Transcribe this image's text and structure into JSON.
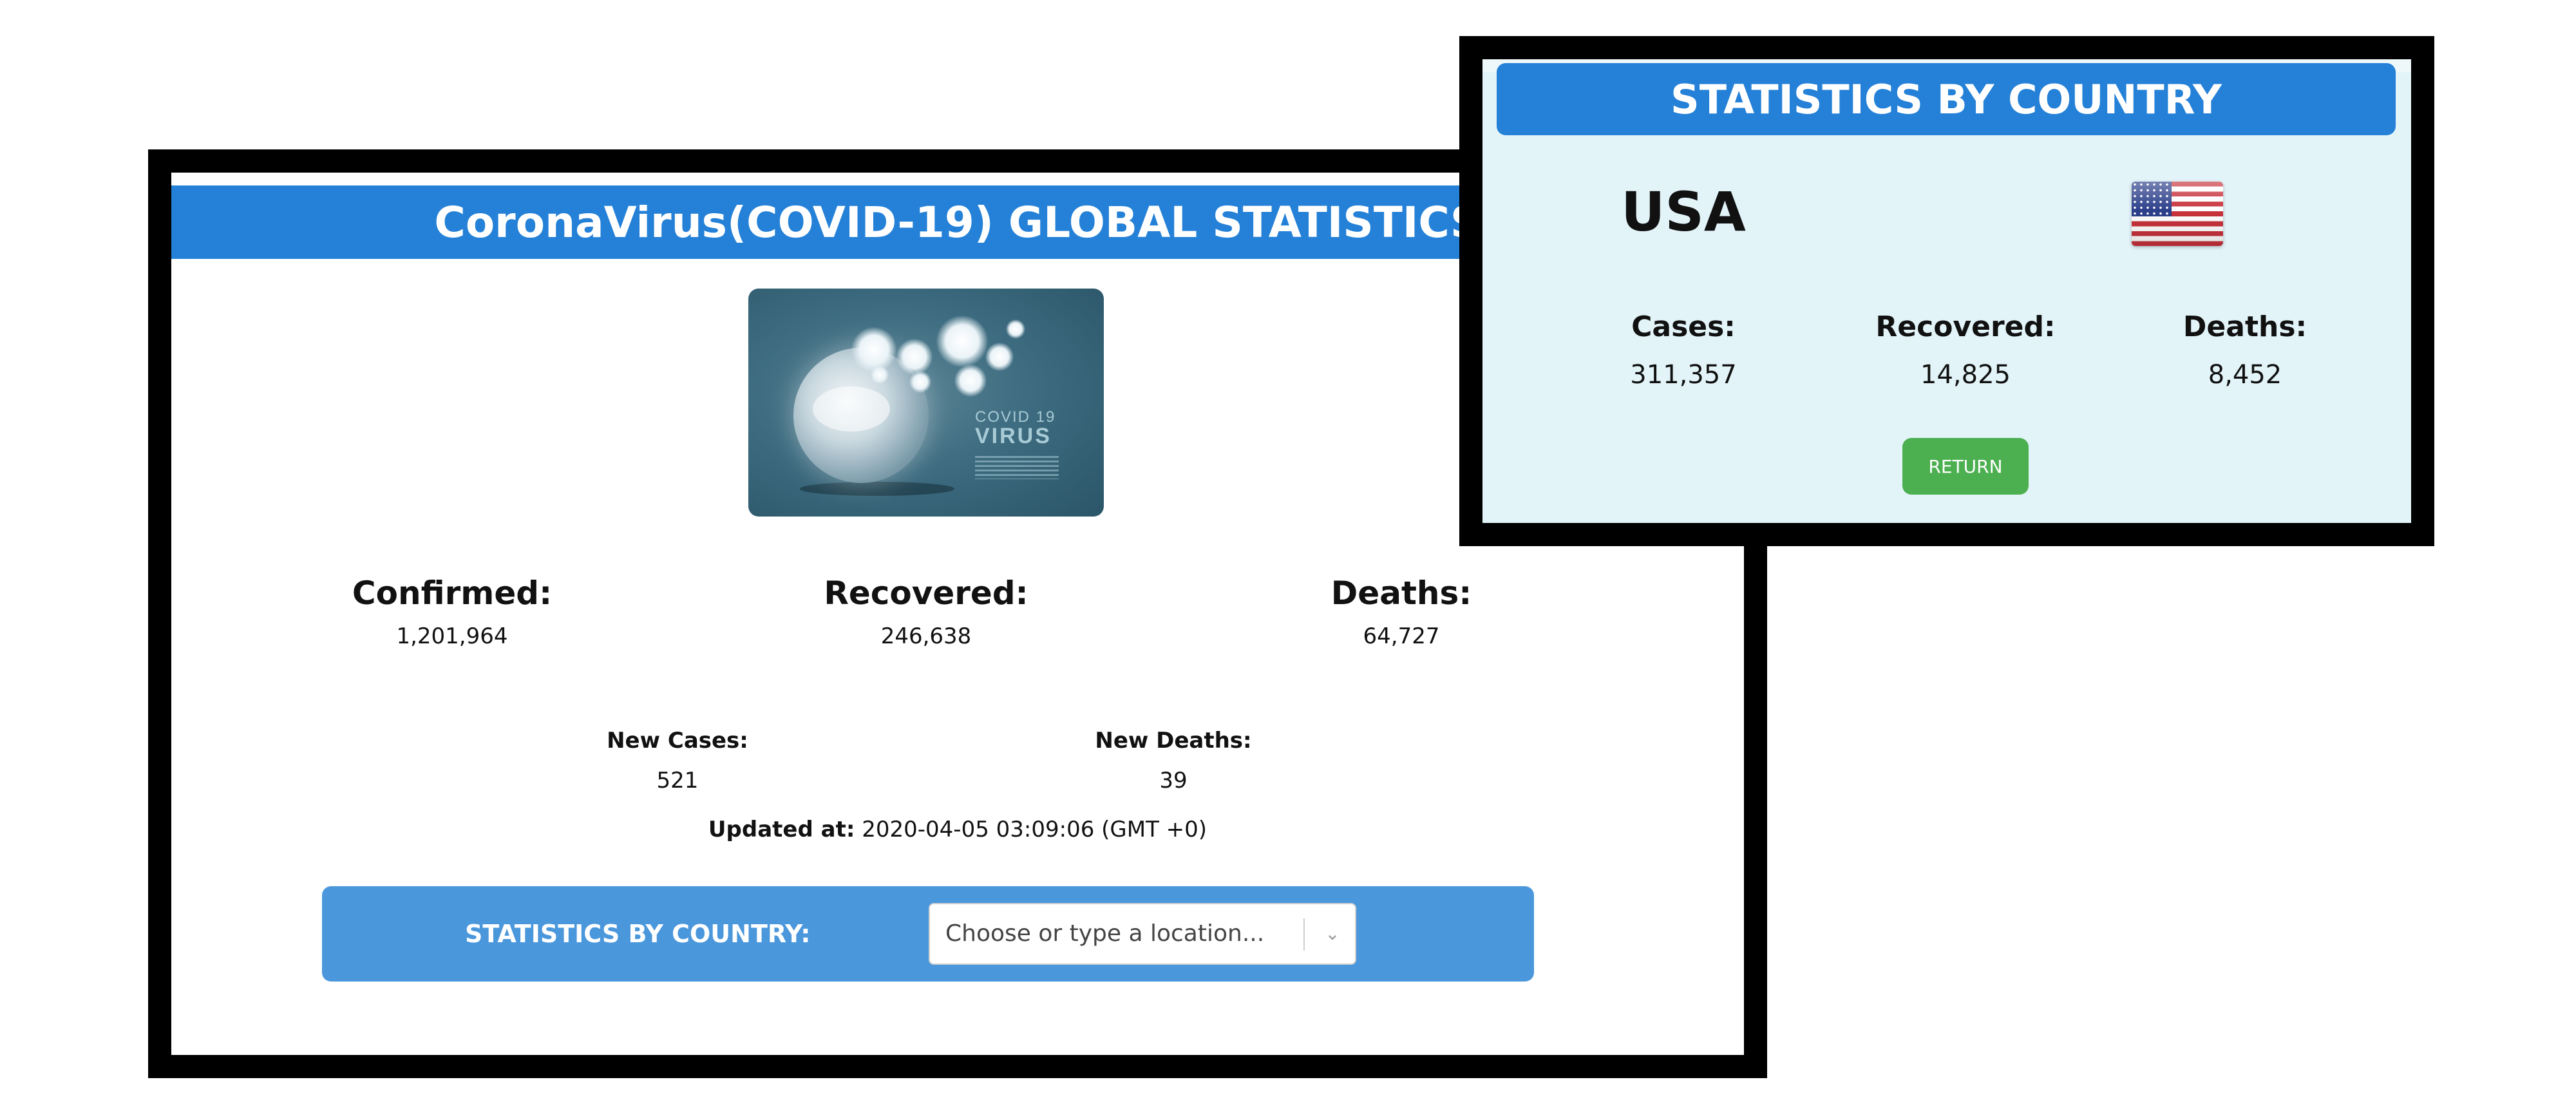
{
  "global": {
    "title": "CoronaVirus(COVID-19) GLOBAL STATISTICS",
    "image": {
      "line1": "COVID 19",
      "line2": "VIRUS"
    },
    "stats": {
      "confirmed_label": "Confirmed:",
      "confirmed_value": "1,201,964",
      "recovered_label": "Recovered:",
      "recovered_value": "246,638",
      "deaths_label": "Deaths:",
      "deaths_value": "64,727",
      "new_cases_label": "New Cases:",
      "new_cases_value": "521",
      "new_deaths_label": "New Deaths:",
      "new_deaths_value": "39"
    },
    "updated_label": "Updated at:",
    "updated_value": "2020-04-05 03:09:06 (GMT +0)",
    "country_bar": {
      "label": "STATISTICS BY COUNTRY:",
      "select_placeholder": "Choose or type a location..."
    }
  },
  "country": {
    "title": "STATISTICS BY COUNTRY",
    "name": "USA",
    "flag_icon": "us-flag-icon",
    "cases_label": "Cases:",
    "cases_value": "311,357",
    "recovered_label": "Recovered:",
    "recovered_value": "14,825",
    "deaths_label": "Deaths:",
    "deaths_value": "8,452",
    "return_label": "RETURN"
  },
  "colors": {
    "header_blue": "#2481d7",
    "bar_blue": "#4a97dc",
    "return_green": "#4caf50",
    "country_bg": "#e3f4f9"
  }
}
